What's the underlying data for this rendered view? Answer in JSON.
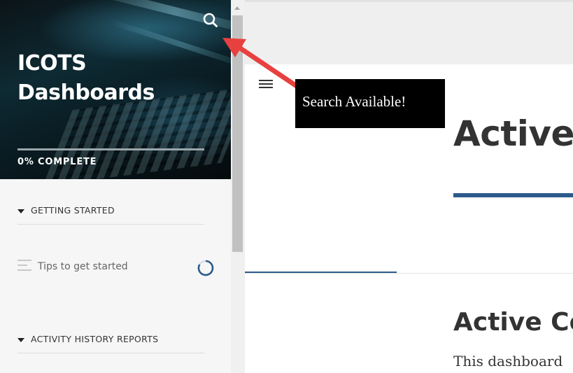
{
  "sidebar": {
    "title": "ICOTS Dashboards",
    "progress": {
      "percent": 0,
      "label": "0% COMPLETE"
    },
    "sections": [
      {
        "label": "GETTING STARTED",
        "lessons": [
          {
            "label": "Tips to get started"
          }
        ]
      },
      {
        "label": "ACTIVITY HISTORY REPORTS",
        "lessons": []
      }
    ]
  },
  "main": {
    "title": "Active C",
    "subtitle": "Active Co",
    "body": "This dashboard"
  },
  "annotation": {
    "text": "Search Available!",
    "arrow_color": "#e8403f"
  },
  "colors": {
    "accent": "#2d5b8c",
    "hero_bg": "#0b1418"
  },
  "icons": {
    "search": "search-icon",
    "menu": "hamburger-menu-icon",
    "lesson": "lines-icon",
    "status": "progress-ring-icon",
    "caret": "caret-down-icon"
  }
}
